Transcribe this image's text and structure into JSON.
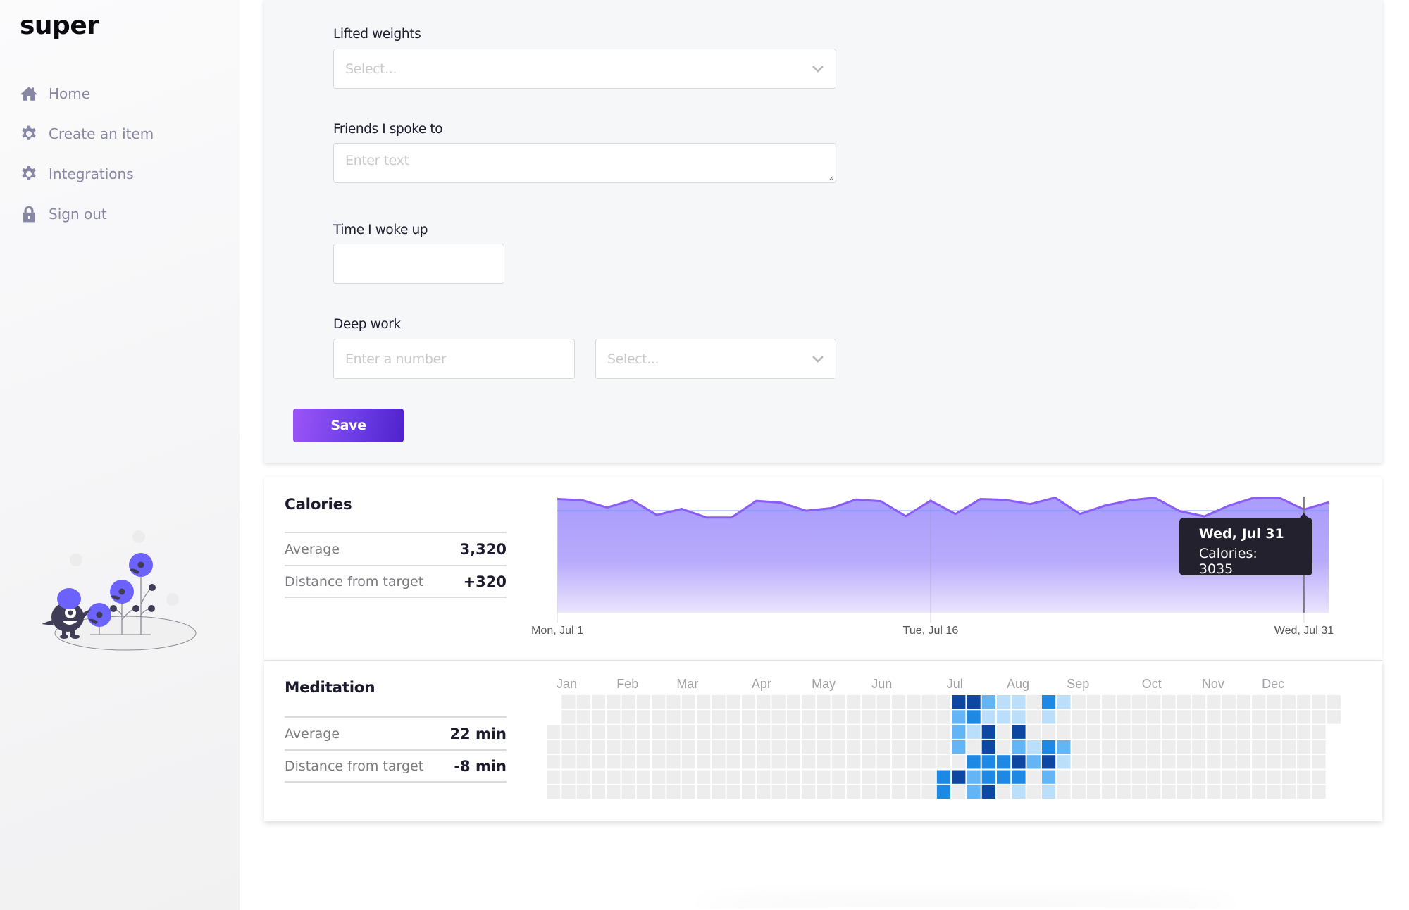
{
  "app": {
    "logo": "super"
  },
  "sidebar": {
    "items": [
      {
        "label": "Home",
        "icon": "home-icon"
      },
      {
        "label": "Create an item",
        "icon": "gear-icon"
      },
      {
        "label": "Integrations",
        "icon": "gear-icon"
      },
      {
        "label": "Sign out",
        "icon": "lock-icon"
      }
    ],
    "nav_color": "#8786a3",
    "illustration": "monster-with-flowers-illustration"
  },
  "form": {
    "fields": {
      "lifted_weights": {
        "label": "Lifted weights",
        "placeholder": "Select...",
        "type": "select"
      },
      "friends": {
        "label": "Friends I spoke to",
        "placeholder": "Enter text",
        "type": "textarea"
      },
      "woke_up": {
        "label": "Time I woke up",
        "value": "",
        "type": "time"
      },
      "deep_work": {
        "label": "Deep work",
        "number_placeholder": "Enter a number",
        "unit_placeholder": "Select...",
        "type": "number+select"
      }
    },
    "save_label": "Save",
    "accent_gradient": [
      "#9b55f7",
      "#4f22cc"
    ]
  },
  "calories": {
    "title": "Calories",
    "stats": [
      {
        "label": "Average",
        "value": "3,320"
      },
      {
        "label": "Distance from target",
        "value": "+320"
      }
    ],
    "tooltip": {
      "title": "Wed, Jul 31",
      "body": "Calories: 3035"
    }
  },
  "meditation": {
    "title": "Meditation",
    "stats": [
      {
        "label": "Average",
        "value": "22 min"
      },
      {
        "label": "Distance from target",
        "value": "-8 min"
      }
    ]
  },
  "chart_data": [
    {
      "type": "area",
      "title": "Calories",
      "xlabel": "",
      "ylabel": "",
      "x": [
        "Jul 1",
        "Jul 2",
        "Jul 3",
        "Jul 4",
        "Jul 5",
        "Jul 6",
        "Jul 7",
        "Jul 8",
        "Jul 9",
        "Jul 10",
        "Jul 11",
        "Jul 12",
        "Jul 13",
        "Jul 14",
        "Jul 15",
        "Jul 16",
        "Jul 17",
        "Jul 18",
        "Jul 19",
        "Jul 20",
        "Jul 21",
        "Jul 22",
        "Jul 23",
        "Jul 24",
        "Jul 25",
        "Jul 26",
        "Jul 27",
        "Jul 28",
        "Jul 29",
        "Jul 30",
        "Jul 31",
        "Aug 1"
      ],
      "series": [
        {
          "name": "Calories",
          "color": "#8b5cf6",
          "values": [
            3345,
            3310,
            3095,
            3310,
            2875,
            3055,
            2800,
            2800,
            3290,
            3235,
            3000,
            3075,
            3330,
            3280,
            2840,
            3295,
            2905,
            3345,
            3320,
            3195,
            3385,
            2905,
            3150,
            3305,
            3385,
            2990,
            2835,
            3155,
            3385,
            3385,
            3035,
            3250
          ]
        }
      ],
      "target": 3000,
      "ylim": [
        0,
        3500
      ],
      "xticks": [
        {
          "index": 0,
          "label": "Mon, Jul 1"
        },
        {
          "index": 15,
          "label": "Tue, Jul 16"
        },
        {
          "index": 30,
          "label": "Wed, Jul 31"
        }
      ],
      "grid": "vertical at ticks",
      "tooltip_index": 30
    },
    {
      "type": "heatmap",
      "title": "Meditation",
      "weeks": 53,
      "first_week_start_day": 2,
      "last_week_end_day": 1,
      "months": [
        {
          "label": "Jan",
          "week": 0
        },
        {
          "label": "Feb",
          "week": 4
        },
        {
          "label": "Mar",
          "week": 8
        },
        {
          "label": "Apr",
          "week": 13
        },
        {
          "label": "May",
          "week": 17
        },
        {
          "label": "Jun",
          "week": 21
        },
        {
          "label": "Jul",
          "week": 26
        },
        {
          "label": "Aug",
          "week": 30
        },
        {
          "label": "Sep",
          "week": 34
        },
        {
          "label": "Oct",
          "week": 39
        },
        {
          "label": "Nov",
          "week": 43
        },
        {
          "label": "Dec",
          "week": 47
        }
      ],
      "levels": [
        "#ededed",
        "#bbdefb",
        "#64b5f6",
        "#1e88e5",
        "#0d47a1"
      ],
      "cells": [
        {
          "week": 27,
          "day": 0,
          "level": 4
        },
        {
          "week": 28,
          "day": 0,
          "level": 4
        },
        {
          "week": 29,
          "day": 0,
          "level": 2
        },
        {
          "week": 30,
          "day": 0,
          "level": 1
        },
        {
          "week": 31,
          "day": 0,
          "level": 1
        },
        {
          "week": 33,
          "day": 0,
          "level": 3
        },
        {
          "week": 34,
          "day": 0,
          "level": 1
        },
        {
          "week": 27,
          "day": 1,
          "level": 2
        },
        {
          "week": 28,
          "day": 1,
          "level": 3
        },
        {
          "week": 29,
          "day": 1,
          "level": 1
        },
        {
          "week": 30,
          "day": 1,
          "level": 1
        },
        {
          "week": 31,
          "day": 1,
          "level": 1
        },
        {
          "week": 33,
          "day": 1,
          "level": 1
        },
        {
          "week": 27,
          "day": 2,
          "level": 2
        },
        {
          "week": 28,
          "day": 2,
          "level": 1
        },
        {
          "week": 29,
          "day": 2,
          "level": 4
        },
        {
          "week": 31,
          "day": 2,
          "level": 4
        },
        {
          "week": 27,
          "day": 3,
          "level": 2
        },
        {
          "week": 29,
          "day": 3,
          "level": 4
        },
        {
          "week": 31,
          "day": 3,
          "level": 2
        },
        {
          "week": 32,
          "day": 3,
          "level": 1
        },
        {
          "week": 33,
          "day": 3,
          "level": 3
        },
        {
          "week": 34,
          "day": 3,
          "level": 2
        },
        {
          "week": 28,
          "day": 4,
          "level": 3
        },
        {
          "week": 29,
          "day": 4,
          "level": 3
        },
        {
          "week": 30,
          "day": 4,
          "level": 3
        },
        {
          "week": 31,
          "day": 4,
          "level": 4
        },
        {
          "week": 32,
          "day": 4,
          "level": 2
        },
        {
          "week": 33,
          "day": 4,
          "level": 4
        },
        {
          "week": 34,
          "day": 4,
          "level": 1
        },
        {
          "week": 26,
          "day": 5,
          "level": 3
        },
        {
          "week": 27,
          "day": 5,
          "level": 4
        },
        {
          "week": 28,
          "day": 5,
          "level": 2
        },
        {
          "week": 29,
          "day": 5,
          "level": 3
        },
        {
          "week": 30,
          "day": 5,
          "level": 3
        },
        {
          "week": 31,
          "day": 5,
          "level": 3
        },
        {
          "week": 33,
          "day": 5,
          "level": 2
        },
        {
          "week": 26,
          "day": 6,
          "level": 3
        },
        {
          "week": 28,
          "day": 6,
          "level": 2
        },
        {
          "week": 29,
          "day": 6,
          "level": 4
        },
        {
          "week": 31,
          "day": 6,
          "level": 1
        },
        {
          "week": 33,
          "day": 6,
          "level": 1
        }
      ]
    }
  ]
}
